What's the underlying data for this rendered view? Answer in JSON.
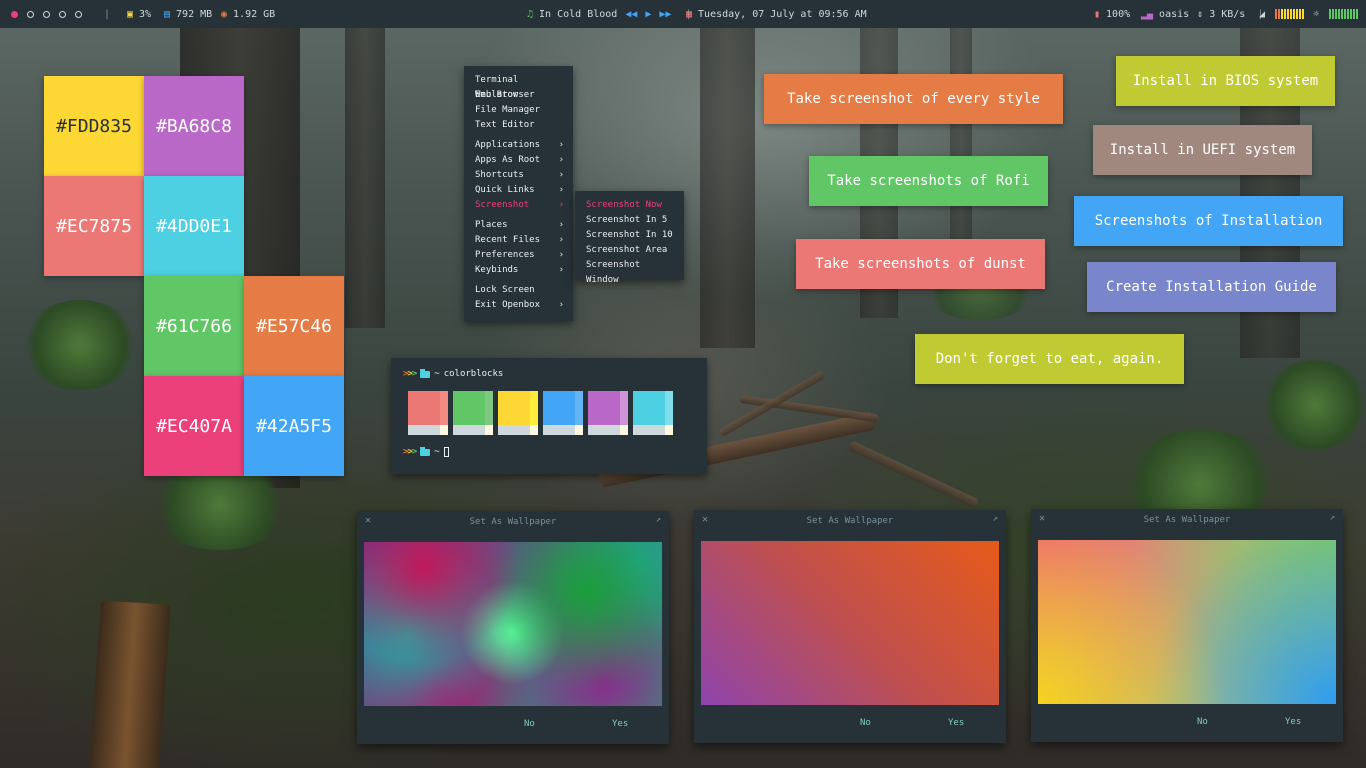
{
  "topbar": {
    "workspaces": [
      {
        "active": true
      },
      {
        "active": false
      },
      {
        "active": false
      },
      {
        "active": false
      },
      {
        "active": false
      }
    ],
    "cpu": "3%",
    "memory": "792 MB",
    "disk": "1.92 GB",
    "music_title": "In Cold Blood",
    "date": "Tuesday, 07 July at 09:56 AM",
    "battery": "100%",
    "wifi": "oasis",
    "network_speed": "3 KB/s"
  },
  "color_blocks": [
    {
      "label": "#FDD835",
      "color": "#FDD835"
    },
    {
      "label": "#BA68C8",
      "color": "#BA68C8"
    },
    {
      "label": "#EC7875",
      "color": "#EC7875"
    },
    {
      "label": "#4DD0E1",
      "color": "#4DD0E1"
    },
    {
      "label": "#61C766",
      "color": "#61C766"
    },
    {
      "label": "#E57C46",
      "color": "#E57C46"
    },
    {
      "label": "#EC407A",
      "color": "#EC407A"
    },
    {
      "label": "#42A5F5",
      "color": "#42A5F5"
    }
  ],
  "menu": {
    "items": [
      {
        "label": "Terminal Emulator",
        "submenu": false
      },
      {
        "label": "Web Browser",
        "submenu": false
      },
      {
        "label": "File Manager",
        "submenu": false
      },
      {
        "label": "Text Editor",
        "submenu": false
      },
      {
        "label": "Applications",
        "submenu": true
      },
      {
        "label": "Apps As Root",
        "submenu": true
      },
      {
        "label": "Shortcuts",
        "submenu": true
      },
      {
        "label": "Quick Links",
        "submenu": true
      },
      {
        "label": "Screenshot",
        "submenu": true
      },
      {
        "label": "Places",
        "submenu": true
      },
      {
        "label": "Recent Files",
        "submenu": true
      },
      {
        "label": "Preferences",
        "submenu": true
      },
      {
        "label": "Keybinds",
        "submenu": true
      },
      {
        "label": "Lock Screen",
        "submenu": false
      },
      {
        "label": "Exit Openbox",
        "submenu": true
      }
    ],
    "submenu_items": [
      "Screenshot Now",
      "Screenshot In 5",
      "Screenshot In 10",
      "Screenshot Area",
      "Screenshot Window"
    ]
  },
  "notifications": [
    {
      "text": "Take screenshot of every style",
      "color": "#E57C46"
    },
    {
      "text": "Take screenshots of Rofi",
      "color": "#61C766"
    },
    {
      "text": "Take screenshots of dunst",
      "color": "#EC7875"
    },
    {
      "text": "Install in BIOS system",
      "color": "#C0CA33"
    },
    {
      "text": "Install in UEFI system",
      "color": "#A1887F"
    },
    {
      "text": "Screenshots of Installation",
      "color": "#42A5F5"
    },
    {
      "text": "Create Installation Guide",
      "color": "#7986CB"
    },
    {
      "text": "Don't forget to eat, again.",
      "color": "#C0CA33"
    }
  ],
  "terminal": {
    "prompt_symbol": ">>>",
    "path": "~",
    "command": "colorblocks",
    "swatches": [
      {
        "main": "#EC7875",
        "side": "#F28B82"
      },
      {
        "main": "#61C766",
        "side": "#81C784"
      },
      {
        "main": "#FDD835",
        "side": "#FFEB3B"
      },
      {
        "main": "#42A5F5",
        "side": "#64B5F6"
      },
      {
        "main": "#BA68C8",
        "side": "#CE93D8"
      },
      {
        "main": "#4DD0E1",
        "side": "#80DEEA"
      }
    ]
  },
  "dialogs": [
    {
      "title": "Set As Wallpaper",
      "no": "No",
      "yes": "Yes"
    },
    {
      "title": "Set As Wallpaper",
      "no": "No",
      "yes": "Yes"
    },
    {
      "title": "Set As Wallpaper",
      "no": "No",
      "yes": "Yes"
    }
  ]
}
